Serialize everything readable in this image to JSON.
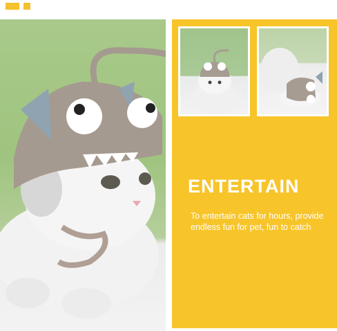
{
  "panel": {
    "headline": "ENTERTAIN",
    "description": "To entertain cats for hours, provide endless fun for pet, fun to catch"
  },
  "colors": {
    "accent_yellow": "#f7c42a",
    "background_green": "#a8c98a",
    "text_white": "#ffffff"
  },
  "images": {
    "hero": "cat wearing grey anglerfish plush hat",
    "thumbnail_1": "cat in anglerfish hat looking at camera",
    "thumbnail_2": "cat lying with anglerfish hat toy"
  }
}
